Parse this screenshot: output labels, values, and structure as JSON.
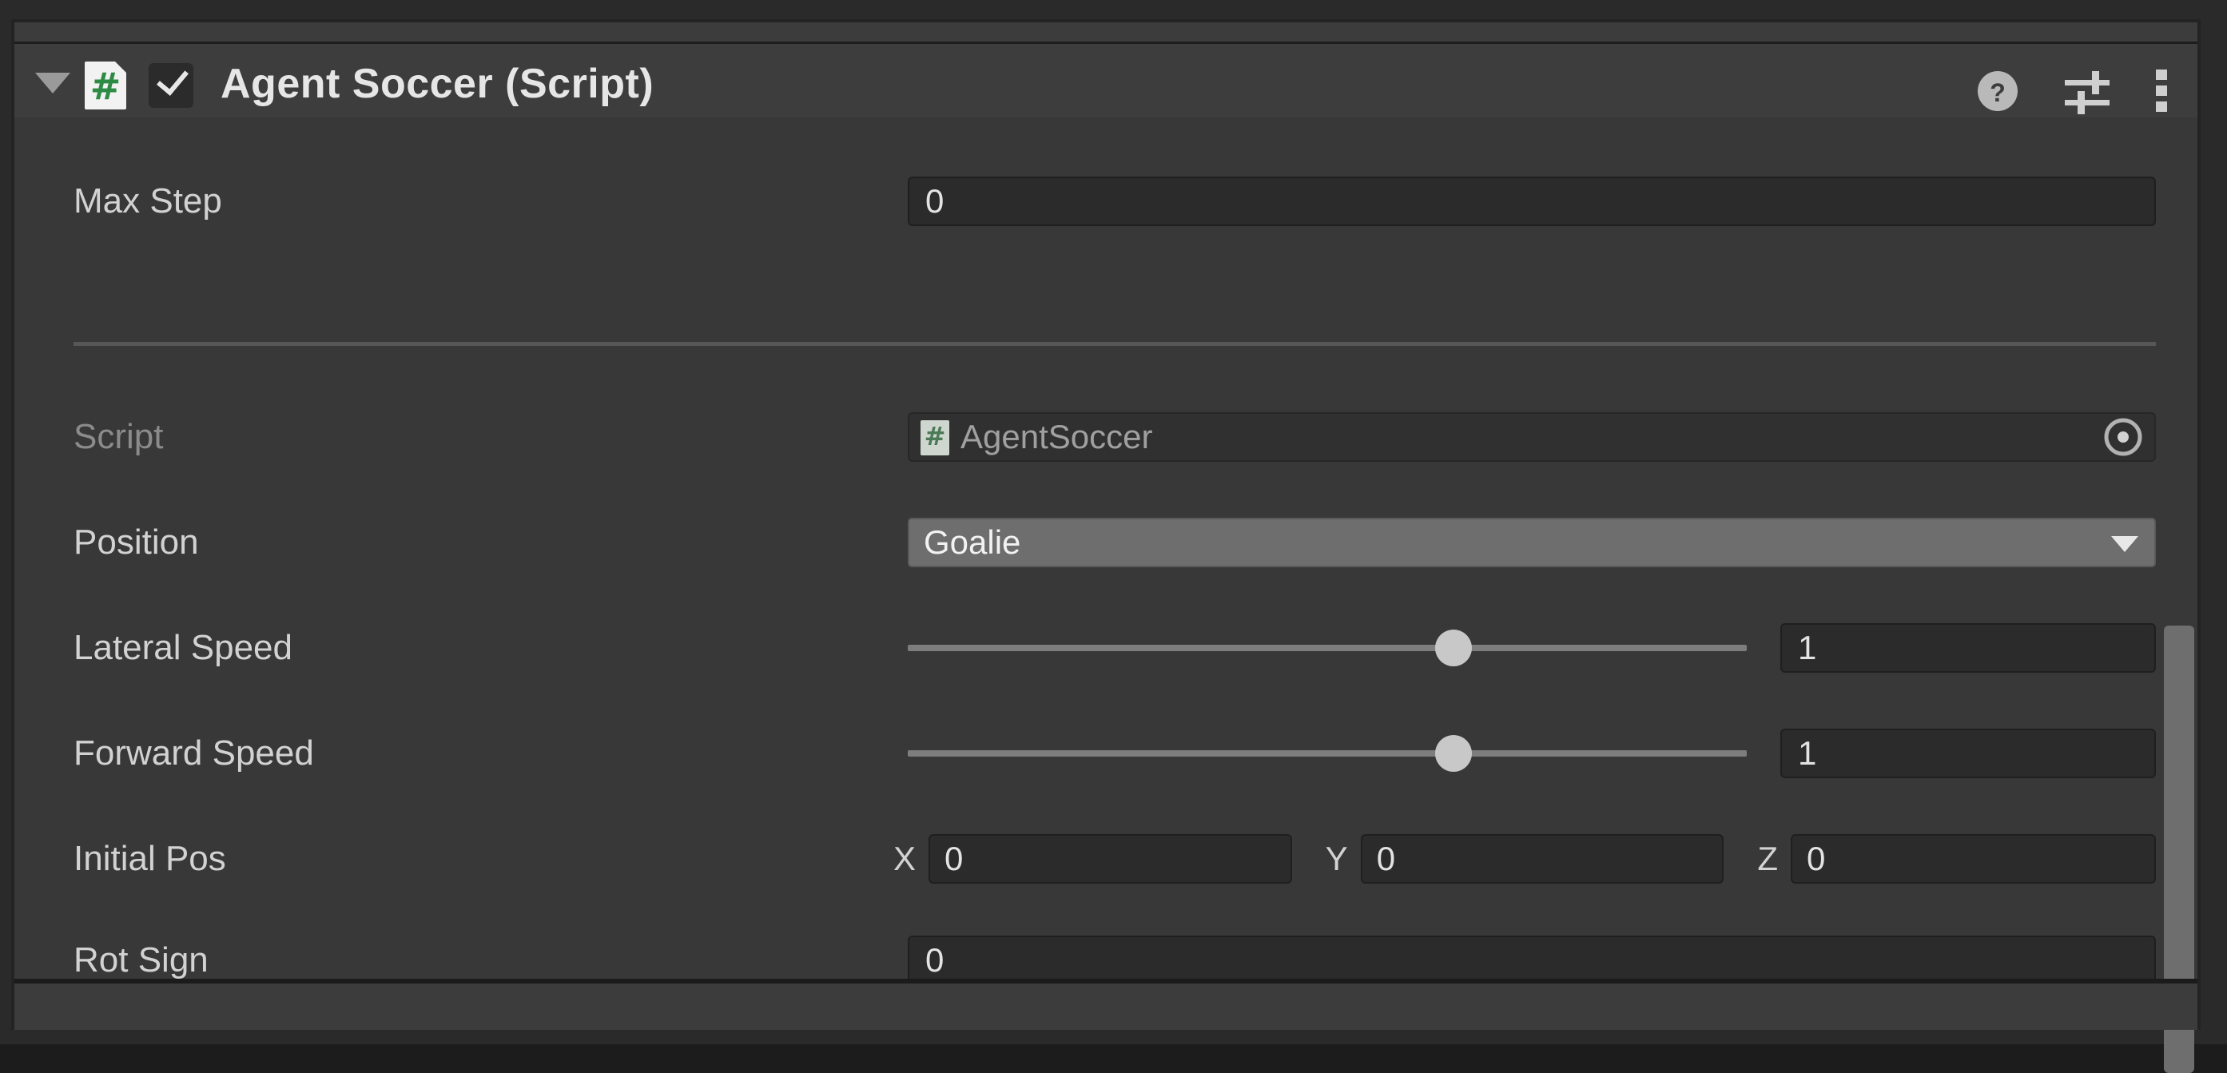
{
  "component": {
    "title": "Agent Soccer (Script)",
    "enabled": true,
    "script_icon": "csharp-script-icon",
    "hash_glyph": "#",
    "foldout_expanded": true,
    "header_icons": [
      {
        "name": "help-icon",
        "label": "?"
      },
      {
        "name": "preset-icon",
        "label": ""
      },
      {
        "name": "more-menu-icon",
        "label": ""
      }
    ]
  },
  "rows": {
    "max_step": {
      "label": "Max Step",
      "value": "0"
    },
    "script": {
      "label": "Script",
      "value": "AgentSoccer",
      "mini_hash": "#",
      "picker": "object-picker-icon"
    },
    "position": {
      "label": "Position",
      "value": "Goalie"
    },
    "lateral_speed": {
      "label": "Lateral Speed",
      "value": "1",
      "handle_pct": 65
    },
    "forward_speed": {
      "label": "Forward Speed",
      "value": "1",
      "handle_pct": 65
    },
    "initial_pos": {
      "label": "Initial Pos",
      "axes": [
        {
          "axis": "X",
          "value": "0"
        },
        {
          "axis": "Y",
          "value": "0"
        },
        {
          "axis": "Z",
          "value": "0"
        }
      ]
    },
    "rot_sign": {
      "label": "Rot Sign",
      "value": "0"
    }
  },
  "colors": {
    "panel_bg": "#383838",
    "header_bg": "#3d3d3d",
    "field_bg": "#2b2b2b",
    "dropdown_bg": "#6e6e6e",
    "script_green": "#2e8b45",
    "text": "#d2d2d2",
    "text_dim": "#8b8b8b"
  }
}
